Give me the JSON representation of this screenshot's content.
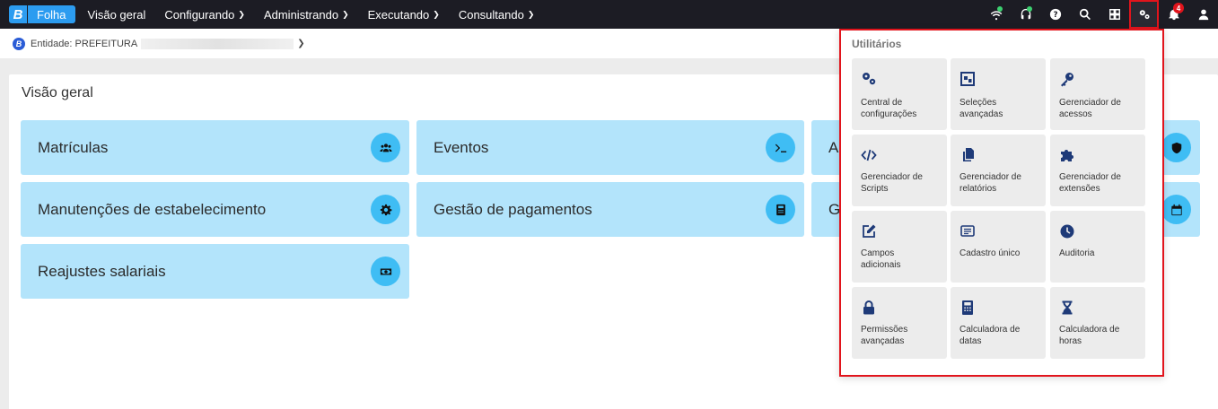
{
  "app": {
    "brand_letter": "B",
    "brand_name": "Folha"
  },
  "nav": [
    {
      "label": "Visão geral",
      "has_menu": false
    },
    {
      "label": "Configurando",
      "has_menu": true
    },
    {
      "label": "Administrando",
      "has_menu": true
    },
    {
      "label": "Executando",
      "has_menu": true
    },
    {
      "label": "Consultando",
      "has_menu": true
    }
  ],
  "top_icons": [
    "wifi-icon",
    "headset-icon",
    "help-icon",
    "search-icon",
    "apps-icon",
    "gears-icon",
    "bell-icon",
    "user-icon"
  ],
  "notifications": {
    "count": "4"
  },
  "entity": {
    "logo_letter": "B",
    "label": "Entidade: PREFEITURA"
  },
  "main": {
    "title": "Visão geral",
    "cards": [
      {
        "label": "Matrículas",
        "icon": "users-icon"
      },
      {
        "label": "Eventos",
        "icon": "terminal-icon"
      },
      {
        "label": "A",
        "icon": "shield-icon"
      },
      {
        "label": "Manutenções de estabelecimento",
        "icon": "gear-icon"
      },
      {
        "label": "Gestão de pagamentos",
        "icon": "calculator-icon"
      },
      {
        "label": "G",
        "icon": "calendar-icon"
      },
      {
        "label": "Reajustes salariais",
        "icon": "money-icon"
      }
    ]
  },
  "utilities": {
    "title": "Utilitários",
    "items": [
      {
        "line1": "Central de",
        "line2": "configurações",
        "icon": "gears-icon"
      },
      {
        "line1": "Seleções",
        "line2": "avançadas",
        "icon": "selection-icon"
      },
      {
        "line1": "Gerenciador de",
        "line2": "acessos",
        "icon": "key-icon"
      },
      {
        "line1": "Gerenciador de",
        "line2": "Scripts",
        "icon": "code-icon"
      },
      {
        "line1": "Gerenciador de",
        "line2": "relatórios",
        "icon": "copy-icon"
      },
      {
        "line1": "Gerenciador de",
        "line2": "extensões",
        "icon": "puzzle-icon"
      },
      {
        "line1": "Campos",
        "line2": "adicionais",
        "icon": "edit-icon"
      },
      {
        "line1": "Cadastro único",
        "line2": "",
        "icon": "list-icon"
      },
      {
        "line1": "Auditoria",
        "line2": "",
        "icon": "clock-icon"
      },
      {
        "line1": "Permissões",
        "line2": "avançadas",
        "icon": "lock-icon"
      },
      {
        "line1": "Calculadora de",
        "line2": "datas",
        "icon": "calculator-icon"
      },
      {
        "line1": "Calculadora de",
        "line2": "horas",
        "icon": "hourglass-icon"
      }
    ]
  }
}
